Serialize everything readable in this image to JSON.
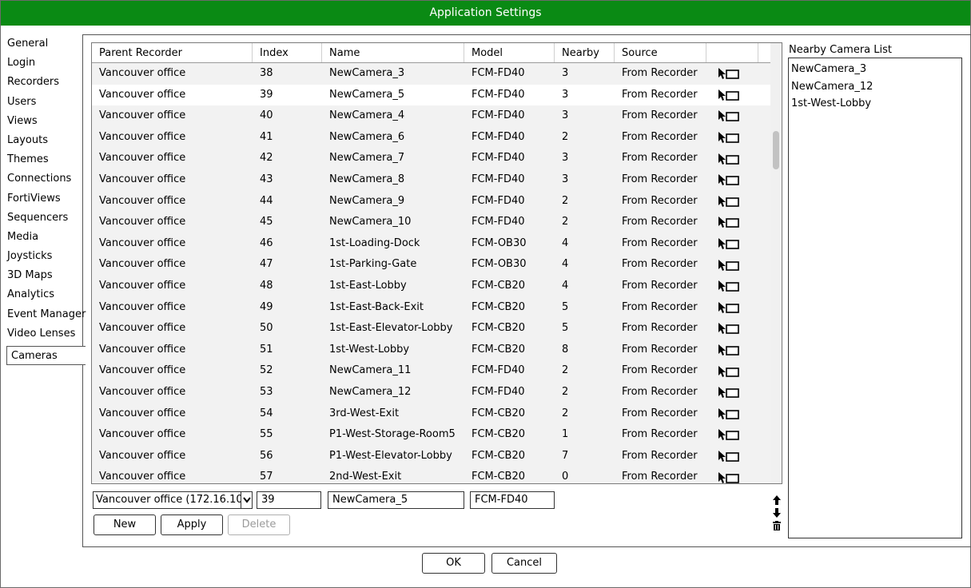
{
  "window": {
    "title": "Application Settings"
  },
  "colors": {
    "titlebar": "#0a8a14",
    "row": "#f2f2f2",
    "selected_row": "#ffffff"
  },
  "nav": {
    "items": [
      "General",
      "Login",
      "Recorders",
      "Users",
      "Views",
      "Layouts",
      "Themes",
      "Connections",
      "FortiViews",
      "Sequencers",
      "Media",
      "Joysticks",
      "3D Maps",
      "Analytics",
      "Event Manager",
      "Video Lenses"
    ],
    "selected": "Cameras"
  },
  "grid": {
    "columns": [
      "Parent Recorder",
      "Index",
      "Name",
      "Model",
      "Nearby",
      "Source",
      ""
    ],
    "selected_index": 1,
    "rows": [
      [
        "Vancouver office",
        "38",
        "NewCamera_3",
        "FCM-FD40",
        "3",
        "From Recorder"
      ],
      [
        "Vancouver office",
        "39",
        "NewCamera_5",
        "FCM-FD40",
        "3",
        "From Recorder"
      ],
      [
        "Vancouver office",
        "40",
        "NewCamera_4",
        "FCM-FD40",
        "3",
        "From Recorder"
      ],
      [
        "Vancouver office",
        "41",
        "NewCamera_6",
        "FCM-FD40",
        "2",
        "From Recorder"
      ],
      [
        "Vancouver office",
        "42",
        "NewCamera_7",
        "FCM-FD40",
        "3",
        "From Recorder"
      ],
      [
        "Vancouver office",
        "43",
        "NewCamera_8",
        "FCM-FD40",
        "3",
        "From Recorder"
      ],
      [
        "Vancouver office",
        "44",
        "NewCamera_9",
        "FCM-FD40",
        "2",
        "From Recorder"
      ],
      [
        "Vancouver office",
        "45",
        "NewCamera_10",
        "FCM-FD40",
        "2",
        "From Recorder"
      ],
      [
        "Vancouver office",
        "46",
        "1st-Loading-Dock",
        "FCM-OB30",
        "4",
        "From Recorder"
      ],
      [
        "Vancouver office",
        "47",
        "1st-Parking-Gate",
        "FCM-OB30",
        "4",
        "From Recorder"
      ],
      [
        "Vancouver office",
        "48",
        "1st-East-Lobby",
        "FCM-CB20",
        "4",
        "From Recorder"
      ],
      [
        "Vancouver office",
        "49",
        "1st-East-Back-Exit",
        "FCM-CB20",
        "5",
        "From Recorder"
      ],
      [
        "Vancouver office",
        "50",
        "1st-East-Elevator-Lobby",
        "FCM-CB20",
        "5",
        "From Recorder"
      ],
      [
        "Vancouver office",
        "51",
        "1st-West-Lobby",
        "FCM-CB20",
        "8",
        "From Recorder"
      ],
      [
        "Vancouver office",
        "52",
        "NewCamera_11",
        "FCM-FD40",
        "2",
        "From Recorder"
      ],
      [
        "Vancouver office",
        "53",
        "NewCamera_12",
        "FCM-FD40",
        "2",
        "From Recorder"
      ],
      [
        "Vancouver office",
        "54",
        "3rd-West-Exit",
        "FCM-CB20",
        "2",
        "From Recorder"
      ],
      [
        "Vancouver office",
        "55",
        "P1-West-Storage-Room5",
        "FCM-CB20",
        "1",
        "From Recorder"
      ],
      [
        "Vancouver office",
        "56",
        "P1-West-Elevator-Lobby",
        "FCM-CB20",
        "7",
        "From Recorder"
      ],
      [
        "Vancouver office",
        "57",
        "2nd-West-Exit",
        "FCM-CB20",
        "0",
        "From Recorder"
      ]
    ],
    "row_icon": "cursor-camera-icon"
  },
  "editor": {
    "recorder_select": "Vancouver office (172.16.10",
    "index": "39",
    "name": "NewCamera_5",
    "model": "FCM-FD40",
    "new_label": "New",
    "apply_label": "Apply",
    "delete_label": "Delete"
  },
  "nearby": {
    "title": "Nearby Camera List",
    "items": [
      "NewCamera_3",
      "NewCamera_12",
      "1st-West-Lobby"
    ]
  },
  "footer": {
    "ok_label": "OK",
    "cancel_label": "Cancel"
  }
}
